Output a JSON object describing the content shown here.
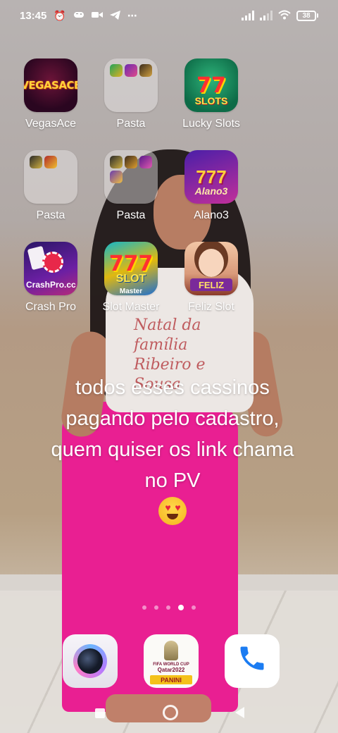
{
  "status_bar": {
    "time": "13:45",
    "left_icons": [
      "alarm-icon",
      "game-controller-icon",
      "video-camera-icon",
      "telegram-icon",
      "more-dots-icon"
    ],
    "right_icons": [
      "signal-strength-icon",
      "signal-strength-secondary-icon",
      "wifi-icon",
      "battery-icon"
    ],
    "battery_level": "38"
  },
  "apps": [
    {
      "label": "VegasAce",
      "icon": "vegasace-app-icon",
      "logo": "VEGASACE"
    },
    {
      "label": "Pasta",
      "icon": "folder-icon"
    },
    {
      "label": "Lucky Slots",
      "icon": "lucky-slots-app-icon",
      "logo": "77",
      "sub": "SLOTS"
    },
    {
      "label": "Pasta",
      "icon": "folder-icon"
    },
    {
      "label": "Pasta",
      "icon": "folder-icon"
    },
    {
      "label": "Alano3",
      "icon": "alano3-app-icon",
      "logo": "777",
      "sub": "Alano3"
    },
    {
      "label": "Crash Pro",
      "icon": "crash-pro-app-icon",
      "sub": "CrashPro.cc"
    },
    {
      "label": "Slot Master",
      "icon": "slot-master-app-icon",
      "logo": "777",
      "sub": "SLOT",
      "sub2": "Master"
    },
    {
      "label": "Feliz Slot",
      "icon": "feliz-slot-app-icon",
      "sub": "FELIZ"
    }
  ],
  "caption": "todos esses cassinos pagando pelo cadastro, quem quiser os link chama no PV",
  "caption_emoji": "smiling-face-with-heart-eyes",
  "shirt_print": "Natal da família Ribeiro e Sousa",
  "pager": {
    "pages": 5,
    "active_index": 3
  },
  "dock": [
    {
      "name": "camera",
      "icon": "camera-app-icon"
    },
    {
      "name": "panini",
      "icon": "panini-world-cup-app-icon",
      "line1": "FIFA WORLD CUP",
      "line2": "Qatar2022",
      "brand": "PANINI"
    },
    {
      "name": "phone",
      "icon": "phone-app-icon"
    }
  ],
  "navbar": [
    "recent-apps-button",
    "home-button",
    "back-button"
  ],
  "colors": {
    "skirt": "#e91f92",
    "status_text": "#ffffff",
    "phone_blue": "#1b7cf2"
  }
}
